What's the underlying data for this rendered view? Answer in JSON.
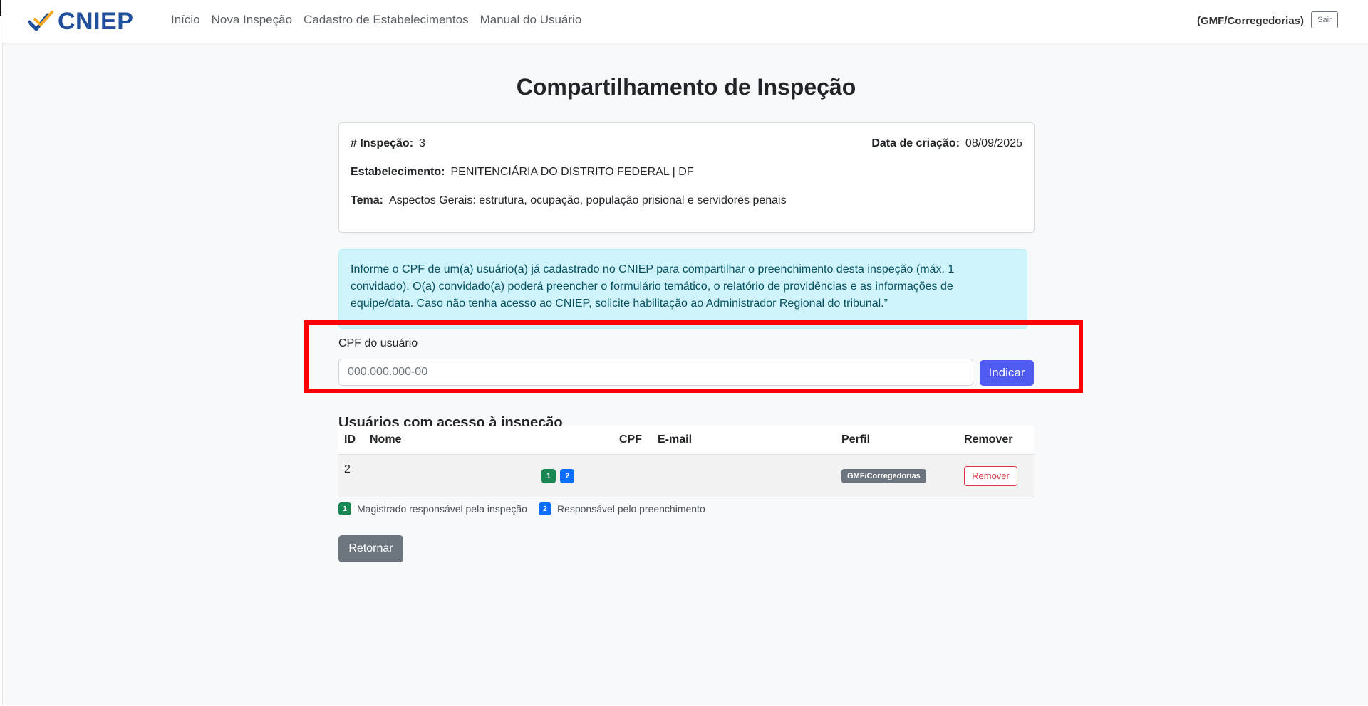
{
  "navbar": {
    "brand": "CNIEP",
    "links": [
      "Início",
      "Nova Inspeção",
      "Cadastro de Estabelecimentos",
      "Manual do Usuário"
    ],
    "user": "(GMF/Corregedorias)",
    "logout_label": "Sair",
    "brand_colors": {
      "check": "#1f4e9c",
      "accent": "#f5a623"
    }
  },
  "page": {
    "title": "Compartilhamento de Inspeção"
  },
  "inspection": {
    "number_label": "# Inspeção:",
    "number": "3",
    "created_label": "Data de criação:",
    "created": "08/09/2025",
    "establishment_label": "Estabelecimento:",
    "establishment": "PENITENCIÁRIA DO DISTRITO FEDERAL | DF",
    "theme_label": "Tema:",
    "theme": "Aspectos Gerais: estrutura, ocupação, população prisional e servidores penais"
  },
  "alert": {
    "text": "Informe o CPF de um(a) usuário(a) já cadastrado no CNIEP para compartilhar o preenchimento desta inspeção (máx. 1 convidado). O(a) convidado(a) poderá preencher o formulário temático, o relatório de providências e as informações de equipe/data. Caso não tenha acesso ao CNIEP, solicite habilitação ao Administrador Regional do tribunal.”"
  },
  "cpf_form": {
    "label": "CPF do usuário",
    "value": "",
    "placeholder": "000.000.000-00",
    "submit_label": "Indicar"
  },
  "users": {
    "title": "Usuários com acesso à inspeção",
    "columns": [
      "ID",
      "Nome",
      "CPF",
      "E-mail",
      "Perfil",
      "Remover"
    ],
    "rows": [
      {
        "id": "2",
        "nome": "",
        "badges": [
          "1",
          "2"
        ],
        "cpf": "",
        "email": "",
        "perfil": "GMF/Corregedorias",
        "remove_label": "Remover"
      }
    ]
  },
  "legend": {
    "badge1": "1",
    "label1": "Magistrado responsável pela inspeção",
    "badge2": "2",
    "label2": "Responsável pelo preenchimento"
  },
  "actions": {
    "return_label": "Retornar"
  }
}
